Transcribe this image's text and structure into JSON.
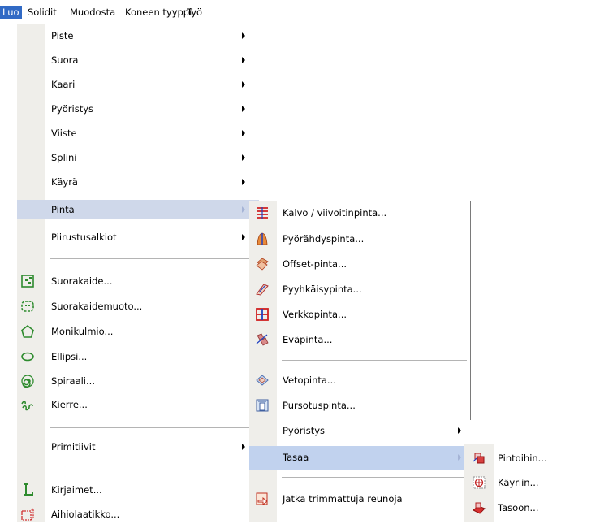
{
  "menubar": {
    "tabs": [
      "Luo",
      "Solidit",
      "Muodosta",
      "Koneen tyyppi",
      "Työ"
    ]
  },
  "main_menu": {
    "items": [
      {
        "label": "Piste"
      },
      {
        "label": "Suora"
      },
      {
        "label": "Kaari"
      },
      {
        "label": "Pyöristys"
      },
      {
        "label": "Viiste"
      },
      {
        "label": "Splini"
      },
      {
        "label": "Käyrä"
      },
      {
        "label": "Pinta"
      },
      {
        "label": "Piirustusalkiot"
      },
      {
        "label": "Suorakaide..."
      },
      {
        "label": "Suorakaidemuoto..."
      },
      {
        "label": "Monikulmio..."
      },
      {
        "label": "Ellipsi..."
      },
      {
        "label": "Spiraali..."
      },
      {
        "label": "Kierre..."
      },
      {
        "label": "Primitiivit"
      },
      {
        "label": "Kirjaimet..."
      },
      {
        "label": "Aihiolaatikko..."
      }
    ]
  },
  "surface_menu": {
    "items": [
      {
        "label": "Kalvo / viivoitinpinta..."
      },
      {
        "label": "Pyörähdyspinta..."
      },
      {
        "label": "Offset-pinta..."
      },
      {
        "label": "Pyyhkäisypinta..."
      },
      {
        "label": "Verkkopinta..."
      },
      {
        "label": "Eväpinta..."
      },
      {
        "label": "Vetopinta..."
      },
      {
        "label": "Pursotuspinta..."
      },
      {
        "label": "Pyöristys"
      },
      {
        "label": "Tasaa"
      },
      {
        "label": "Jatka trimmattuja reunoja"
      }
    ]
  },
  "flat_menu": {
    "items": [
      {
        "label": "Pintoihin..."
      },
      {
        "label": "Käyriin..."
      },
      {
        "label": "Tasoon..."
      }
    ]
  },
  "colors": {
    "selection": "#316ac5",
    "hover_highlight": "#cfd8ea",
    "icon_strip": "#efeeea"
  }
}
